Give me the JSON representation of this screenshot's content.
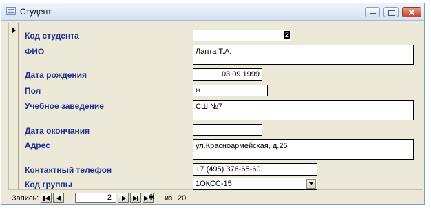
{
  "window": {
    "title": "Студент",
    "icon": "form-icon"
  },
  "fields": {
    "kod_studenta": {
      "label": "Код студента",
      "value": "2"
    },
    "fio": {
      "label": "ФИО",
      "value": "Лапта Т.А."
    },
    "data_rozhdeniya": {
      "label": "Дата рождения",
      "value": "03.09.1999"
    },
    "pol": {
      "label": "Пол",
      "value": "ж"
    },
    "uchebnoe_zavedenie": {
      "label": "Учебное заведение",
      "value": "СШ №7"
    },
    "data_okonchaniya": {
      "label": "Дата окончания",
      "value": ""
    },
    "adres": {
      "label": "Адрес",
      "value": "ул.Красноармейская, д.25"
    },
    "kontaktny_telefon": {
      "label": "Контактный телефон",
      "value": "+7 (495) 376-65-60"
    },
    "kod_gruppy": {
      "label": "Код группы",
      "value": "1ОКСС-15"
    }
  },
  "navigation": {
    "label": "Запись:",
    "current": "2",
    "of_label": "из",
    "total": "20"
  }
}
